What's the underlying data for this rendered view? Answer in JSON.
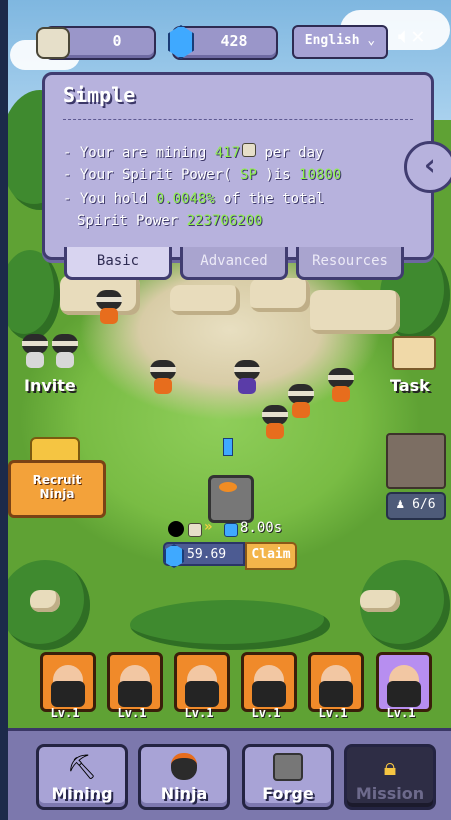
{
  "topbar": {
    "coins": "0",
    "gems": "428",
    "language": "English",
    "language_icon": "chevron-down-icon",
    "sound_icon": "speaker-muted-icon"
  },
  "info": {
    "title": "Simple",
    "mining_prefix": "- Your are mining ",
    "mining_value": "417",
    "mining_suffix": " per day",
    "spirit_prefix": "- Your Spirit Power( ",
    "spirit_sp": "SP",
    "spirit_mid": " )is ",
    "spirit_value": "10800",
    "hold_prefix": "- You hold ",
    "hold_value": "0.0048%",
    "hold_suffix": " of the total",
    "total_prefix": "Spirit Power ",
    "total_value": "223706200",
    "tabs": [
      "Basic",
      "Advanced",
      "Resources"
    ]
  },
  "side": {
    "invite": "Invite",
    "task": "Task",
    "recruit": "Recruit Ninja",
    "capacity": "6/6"
  },
  "forge": {
    "timer": "8.00s",
    "earned": "59.69",
    "claim": "Claim"
  },
  "roster": [
    {
      "level": "Lv.1",
      "color": "#f08a2a"
    },
    {
      "level": "Lv.1",
      "color": "#f08a2a"
    },
    {
      "level": "Lv.1",
      "color": "#f08a2a"
    },
    {
      "level": "Lv.1",
      "color": "#f08a2a"
    },
    {
      "level": "Lv.1",
      "color": "#f08a2a"
    },
    {
      "level": "Lv.1",
      "color": "#b78ef0"
    }
  ],
  "nav": {
    "mining": "Mining",
    "ninja": "Ninja",
    "forge": "Forge",
    "mission": "Mission"
  },
  "colors": {
    "panel": "#b7b2dd",
    "accent_green": "#8ff04c",
    "claim": "#f3b54a"
  }
}
